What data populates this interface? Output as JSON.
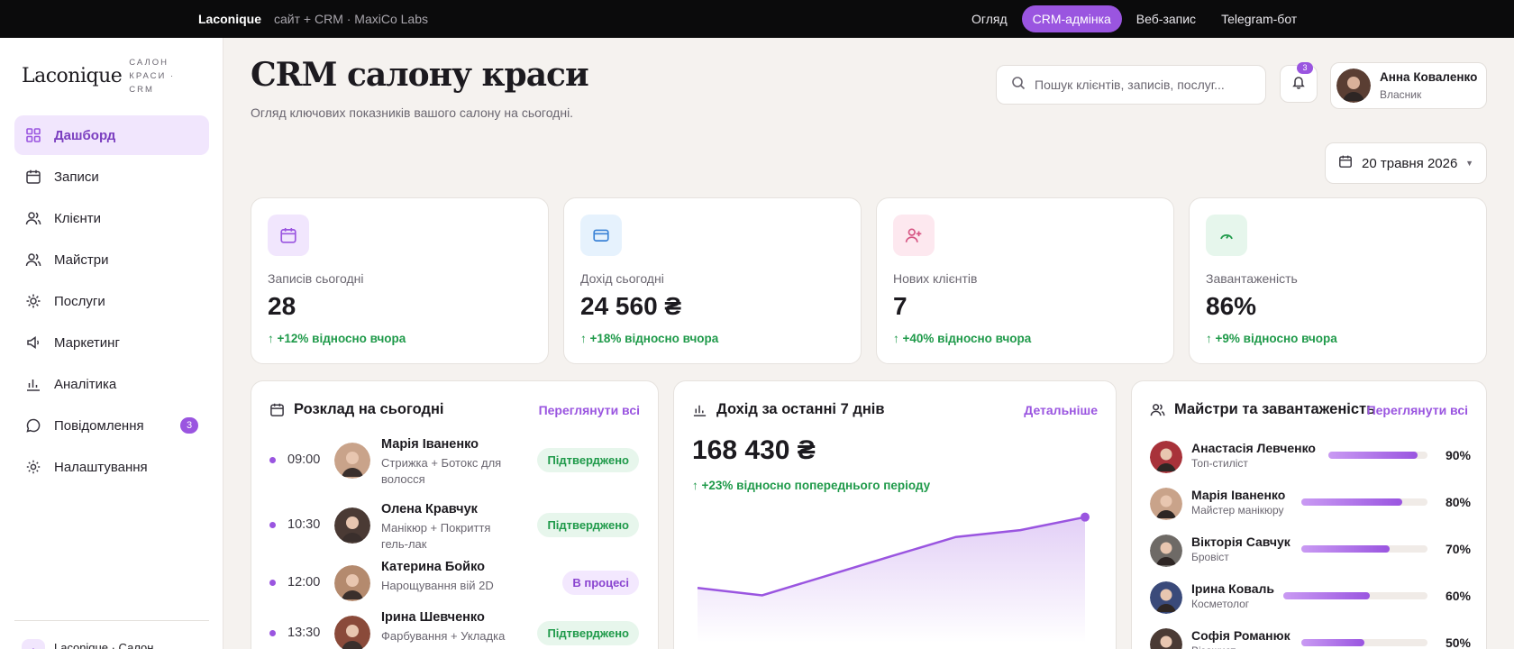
{
  "topbar": {
    "brand": "Laconique",
    "subtitle": "сайт + CRM · MaxiCo Labs",
    "nav": [
      "Огляд",
      "CRM-адмінка",
      "Веб-запис",
      "Telegram-бот"
    ],
    "active_nav": "CRM-адмінка"
  },
  "sidebar": {
    "logo": "Laconique",
    "logo_tag": "САЛОН КРАСИ · CRM",
    "items": [
      {
        "label": "Дашборд",
        "icon": "grid-icon",
        "active": true
      },
      {
        "label": "Записи",
        "icon": "calendar-icon"
      },
      {
        "label": "Клієнти",
        "icon": "users-icon"
      },
      {
        "label": "Майстри",
        "icon": "users-icon"
      },
      {
        "label": "Послуги",
        "icon": "sparkle-icon"
      },
      {
        "label": "Маркетинг",
        "icon": "megaphone-icon"
      },
      {
        "label": "Аналітика",
        "icon": "bar-chart-icon"
      },
      {
        "label": "Повідомлення",
        "icon": "chat-icon",
        "badge": "3"
      },
      {
        "label": "Налаштування",
        "icon": "gear-icon"
      }
    ],
    "footer": "Laconique · Салон"
  },
  "header": {
    "title": "CRM салону краси",
    "subtitle": "Огляд ключових показників вашого салону на сьогодні.",
    "search_placeholder": "Пошук клієнтів, записів, послуг...",
    "notifications": "3",
    "user_name": "Анна Коваленко",
    "user_role": "Власник",
    "date": "20 травня 2026"
  },
  "kpis": [
    {
      "label": "Записів сьогодні",
      "value": "28",
      "delta": "+12% відносно вчора",
      "icon": "calendar-icon",
      "tint": "#f1e6fd",
      "color": "#9a55e0"
    },
    {
      "label": "Дохід сьогодні",
      "value": "24 560 ₴",
      "delta": "+18% відносно вчора",
      "icon": "wallet-icon",
      "tint": "#e6f2fd",
      "color": "#3a82d6"
    },
    {
      "label": "Нових клієнтів",
      "value": "7",
      "delta": "+40% відносно вчора",
      "icon": "user-plus-icon",
      "tint": "#fde8ef",
      "color": "#d65583"
    },
    {
      "label": "Завантаженість",
      "value": "86%",
      "delta": "+9% відносно вчора",
      "icon": "gauge-icon",
      "tint": "#e6f6ec",
      "color": "#1f9a4a"
    }
  ],
  "schedule": {
    "title": "Розклад на сьогодні",
    "link": "Переглянути всі",
    "rows": [
      {
        "time": "09:00",
        "name": "Марія Іваненко",
        "service": "Стрижка + Ботокс для волосся",
        "status": "Підтверджено",
        "kind": "ok",
        "avatar": "#c9a38a"
      },
      {
        "time": "10:30",
        "name": "Олена Кравчук",
        "service": "Манікюр + Покриття гель-лак",
        "status": "Підтверджено",
        "kind": "ok",
        "avatar": "#4a3a34"
      },
      {
        "time": "12:00",
        "name": "Катерина Бойко",
        "service": "Нарощування вій 2D",
        "status": "В процесі",
        "kind": "pr",
        "avatar": "#b48a6e"
      },
      {
        "time": "13:30",
        "name": "Ірина Шевченко",
        "service": "Фарбування + Укладка",
        "status": "Підтверджено",
        "kind": "ok",
        "avatar": "#8a4a3a"
      }
    ]
  },
  "revenue": {
    "title": "Дохід за останні 7 днів",
    "link": "Детальніше",
    "total": "168 430 ₴",
    "delta": "+23% відносно попереднього періоду"
  },
  "chart_data": {
    "type": "area",
    "title": "Дохід за останні 7 днів",
    "x": [
      1,
      2,
      3,
      4,
      5,
      6,
      7
    ],
    "values": [
      16800,
      14500,
      20500,
      26500,
      32400,
      34500,
      38500
    ],
    "ylim": [
      0,
      42000
    ],
    "grid": false,
    "color": "#9a55e0"
  },
  "masters": {
    "title": "Майстри та завантаженість",
    "link": "Переглянути всі",
    "rows": [
      {
        "name": "Анастасія Левченко",
        "role": "Топ-стиліст",
        "pct": 90,
        "pct_label": "90%",
        "avatar": "#a8323a"
      },
      {
        "name": "Марія Іваненко",
        "role": "Майстер манікюру",
        "pct": 80,
        "pct_label": "80%",
        "avatar": "#c9a38a"
      },
      {
        "name": "Вікторія Савчук",
        "role": "Бровіст",
        "pct": 70,
        "pct_label": "70%",
        "avatar": "#6e6a66"
      },
      {
        "name": "Ірина Коваль",
        "role": "Косметолог",
        "pct": 60,
        "pct_label": "60%",
        "avatar": "#3a4a7a"
      },
      {
        "name": "Софія Романюк",
        "role": "Візажист",
        "pct": 50,
        "pct_label": "50%",
        "avatar": "#4a3a34"
      }
    ]
  }
}
